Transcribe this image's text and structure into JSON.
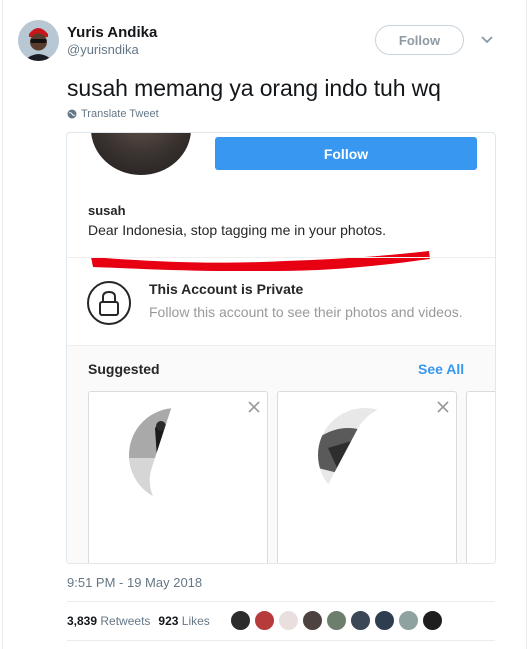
{
  "author": {
    "name": "Yuris Andika",
    "handle": "@yurisndika",
    "follow_label": "Follow"
  },
  "tweet": {
    "text": "susah memang ya orang indo tuh wq",
    "translate_label": "Translate Tweet"
  },
  "embedded_screenshot": {
    "follow_label": "Follow",
    "username": "susah",
    "bio": "Dear Indonesia, stop tagging me in your photos.",
    "private_title": "This Account is Private",
    "private_subtitle": "Follow this account to see their photos and videos.",
    "suggested_label": "Suggested",
    "see_all_label": "See All"
  },
  "footer": {
    "timestamp": "9:51 PM - 19 May 2018",
    "retweets_count": "3,839",
    "retweets_label": "Retweets",
    "likes_count": "923",
    "likes_label": "Likes"
  },
  "colors": {
    "twitter_gray": "#657786",
    "instagram_blue": "#3897f0",
    "redline": "#e60012"
  },
  "icons": [
    "chevron-down-icon",
    "globe-icon",
    "lock-icon",
    "close-icon"
  ]
}
